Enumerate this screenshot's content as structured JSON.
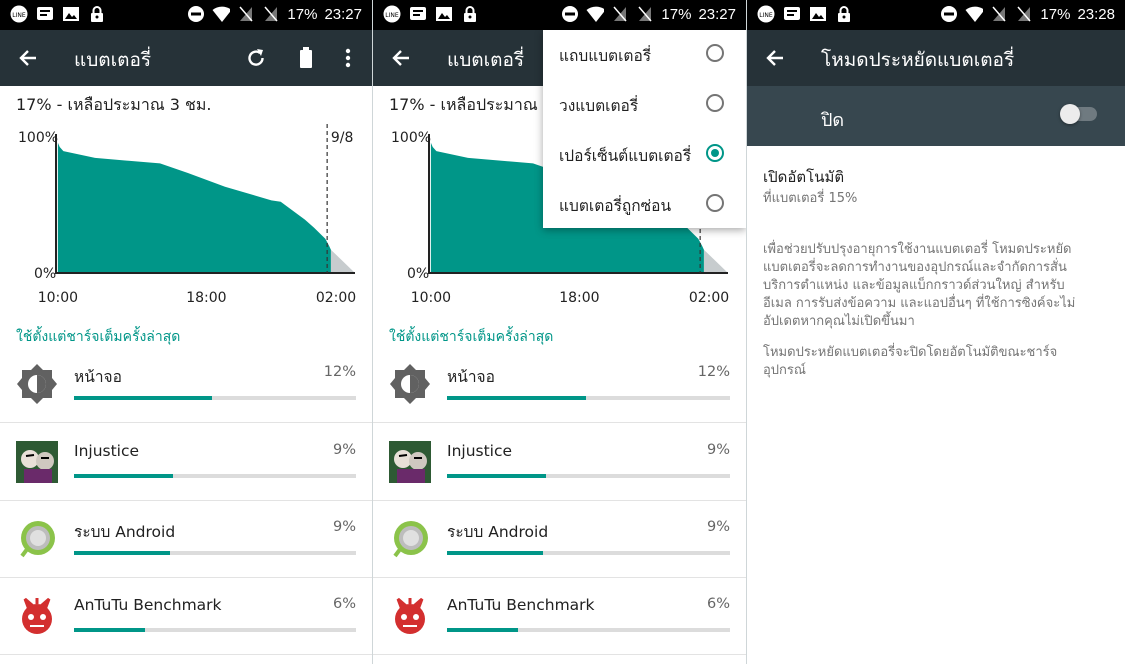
{
  "status": {
    "battery": "17%",
    "time_a": "23:27",
    "time_b": "23:27",
    "time_c": "23:28"
  },
  "colors": {
    "appbar": "#263238",
    "accent": "#009688",
    "switchbar": "#37474f"
  },
  "icons": {
    "back": "arrow-back-icon",
    "refresh": "refresh-icon",
    "battery": "battery-icon",
    "more": "more-vert-icon"
  },
  "battery_screen": {
    "title": "แบตเตอรี่",
    "summary": "17% - เหลือประมาณ 3 ชม.",
    "section_title": "ใช้ตั้งแต่ชาร์จเต็มครั้งล่าสุด",
    "usage": [
      {
        "name": "หน้าจอ",
        "percent": "12%",
        "fraction": 0.49
      },
      {
        "name": "Injustice",
        "percent": "9%",
        "fraction": 0.35
      },
      {
        "name": "ระบบ Android",
        "percent": "9%",
        "fraction": 0.34
      },
      {
        "name": "AnTuTu Benchmark",
        "percent": "6%",
        "fraction": 0.25
      }
    ]
  },
  "chart_data": {
    "type": "area",
    "ylabel_top": "100%",
    "ylabel_bottom": "0%",
    "x_tick_labels": [
      "10:00",
      "18:00",
      "02:00"
    ],
    "marker_label": "9/8",
    "x_range_hours": [
      9.9,
      26.0
    ],
    "y_range_percent": [
      0,
      100
    ],
    "series": [
      {
        "values_hours": [
          10.0,
          10.1,
          10.3,
          12,
          15.5,
          17,
          19,
          21.5,
          22.0,
          23.0,
          23.3,
          23.8,
          24.4,
          24.6,
          24.7
        ],
        "values_percent": [
          95,
          92,
          89,
          84,
          80,
          73,
          63,
          53,
          52,
          42,
          39,
          33,
          25,
          20,
          17
        ]
      }
    ],
    "projection_until_hours": 26.0,
    "marker_hours": 24.5
  },
  "menu": {
    "items": [
      {
        "label": "แถบแบตเตอรี่",
        "selected": false
      },
      {
        "label": "วงแบตเตอรี่",
        "selected": false
      },
      {
        "label": "เปอร์เซ็นต์แบตเตอรี่",
        "selected": true
      },
      {
        "label": "แบตเตอรี่ถูกซ่อน",
        "selected": false
      }
    ]
  },
  "saver_screen": {
    "title": "โหมดประหยัดแบตเตอรี่",
    "switch_label": "ปิด",
    "switch_on": false,
    "auto_title": "เปิดอัตโนมัติ",
    "auto_subtitle": "ที่แบตเตอรี่ 15%",
    "desc_lines_1": [
      "เพื่อช่วยปรับปรุงอายุการใช้งานแบตเตอรี่ โหมดประหยัด",
      "แบตเตอรี่จะลดการทำงานของอุปกรณ์และจำกัดการสั่น",
      "บริการตำแหน่ง และข้อมูลแบ็กกราวด์ส่วนใหญ่ สำหรับ",
      "อีเมล การรับส่งข้อความ และแอปอื่นๆ ที่ใช้การซิงค์จะไม่",
      "อัปเดตหากคุณไม่เปิดขึ้นมา"
    ],
    "desc_lines_2": [
      "โหมดประหยัดแบตเตอรี่จะปิดโดยอัตโนมัติขณะชาร์จ",
      "อุปกรณ์"
    ]
  }
}
